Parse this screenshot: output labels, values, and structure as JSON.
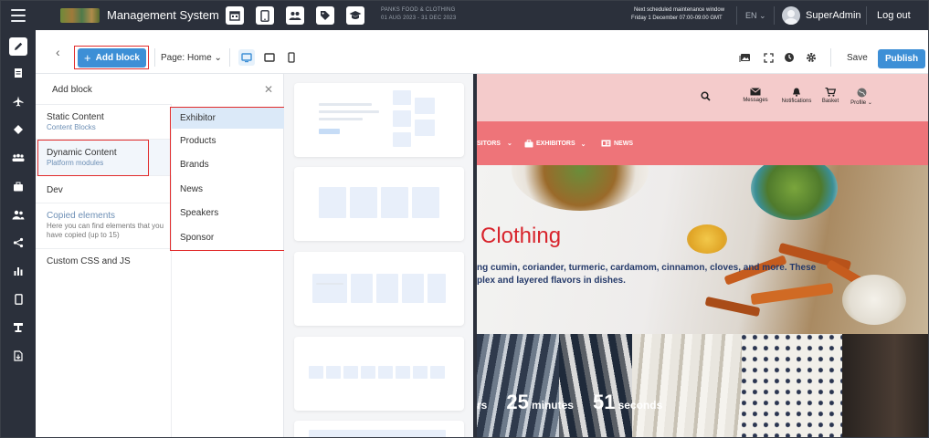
{
  "app": {
    "title": "Management System",
    "event_name": "PANKS FOOD & CLOTHING",
    "event_dates": "01 AUG 2023 - 31 DEC 2023",
    "maintenance_title": "Next scheduled maintenance window",
    "maintenance_time": "Friday 1 December 07:00-09:00 GMT",
    "language": "EN",
    "user_name": "SuperAdmin",
    "logout_label": "Log out",
    "top_icons": [
      "calendar-icon",
      "mobile-icon",
      "users-icon",
      "tag-icon",
      "graduation-icon"
    ]
  },
  "rail": {
    "items": [
      "pencil-icon",
      "document-icon",
      "plane-icon",
      "tag-icon",
      "audience-icon",
      "briefcase-icon",
      "people-icon",
      "share-icon",
      "bar-chart-icon",
      "mobile-icon",
      "stand-icon",
      "file-export-icon"
    ],
    "active_index": 0
  },
  "toolbar": {
    "add_block_label": "Add block",
    "page_label": "Page:",
    "page_value": "Home",
    "devices": [
      "desktop-icon",
      "tablet-icon",
      "mobile-icon"
    ],
    "active_device": "desktop-icon",
    "tools": [
      "media-icon",
      "fullscreen-icon",
      "history-icon",
      "settings-icon"
    ],
    "save_label": "Save",
    "publish_label": "Publish"
  },
  "panel": {
    "title": "Add block",
    "categories": [
      {
        "name": "Static Content",
        "sub": "Content Blocks"
      },
      {
        "name": "Dynamic Content",
        "sub": "Platform modules"
      },
      {
        "name": "Dev",
        "sub": ""
      },
      {
        "name": "Copied elements",
        "sub": "Here you can find elements that you have copied (up to 15)"
      },
      {
        "name": "Custom CSS and JS",
        "sub": ""
      }
    ],
    "active_category": 1,
    "modules": [
      "Exhibitor",
      "Products",
      "Brands",
      "News",
      "Speakers",
      "Sponsor"
    ],
    "active_module": 0
  },
  "preview": {
    "header_icons": [
      {
        "icon": "search-icon",
        "label": ""
      },
      {
        "icon": "envelope-icon",
        "label": "Messages"
      },
      {
        "icon": "bell-icon",
        "label": "Notifications"
      },
      {
        "icon": "cart-icon",
        "label": "Basket"
      },
      {
        "icon": "globe-icon",
        "label": "Profile"
      }
    ],
    "nav": [
      {
        "label": "SITORS",
        "icon": ""
      },
      {
        "label": "EXHIBITORS",
        "icon": "briefcase-icon"
      },
      {
        "label": "NEWS",
        "icon": "news-icon"
      }
    ],
    "hero_title": "Clothing",
    "hero_line1": "ng cumin, coriander, turmeric, cardamom, cinnamon, cloves, and more. These",
    "hero_line2": "plex and layered flavors in dishes.",
    "countdown": {
      "hours_unit": "rs",
      "minutes_value": "25",
      "minutes_unit": "minutes",
      "seconds_value": "51",
      "seconds_unit": "seconds"
    }
  },
  "colors": {
    "topbar": "#2b303b",
    "accent": "#3d8fd6",
    "highlight": "#e12b2b",
    "site_header": "#f4cbcb",
    "site_nav": "#ee7479",
    "hero_title": "#d8242c"
  }
}
